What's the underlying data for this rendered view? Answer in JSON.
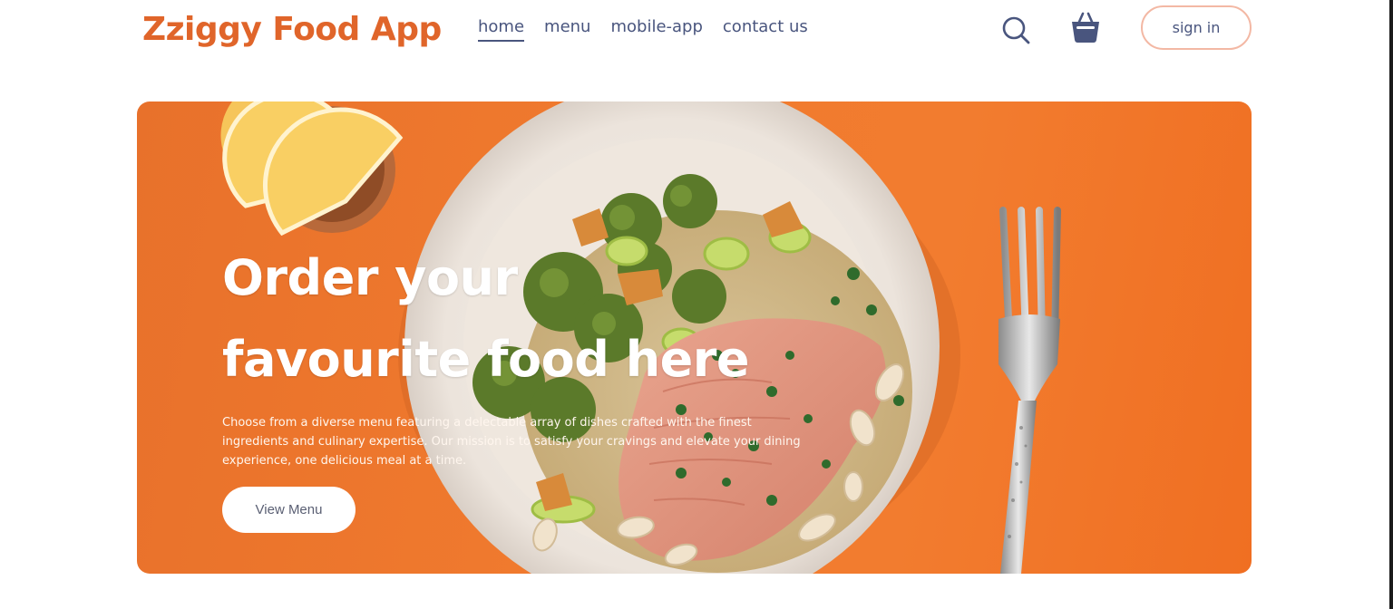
{
  "navbar": {
    "logo": "Zziggy Food App",
    "menu": [
      {
        "label": "home",
        "active": true
      },
      {
        "label": "menu",
        "active": false
      },
      {
        "label": "mobile-app",
        "active": false
      },
      {
        "label": "contact us",
        "active": false
      }
    ],
    "icons": {
      "search": "search-icon",
      "basket": "basket-icon"
    },
    "signin_label": "sign in"
  },
  "hero": {
    "title_line1": "Order your",
    "title_line2": "favourite food here",
    "description": "Choose from a diverse menu featuring a delectable array of dishes crafted with the finest ingredients and culinary expertise. Our mission is to satisfy your cravings and elevate your dining experience, one delicious meal at a time.",
    "button_label": "View Menu",
    "image": "food-plate-image"
  },
  "colors": {
    "brand": "#e0652a",
    "nav_text": "#49557e",
    "hero_bg": "#f07a2e",
    "signin_border": "#f3b8a4"
  }
}
